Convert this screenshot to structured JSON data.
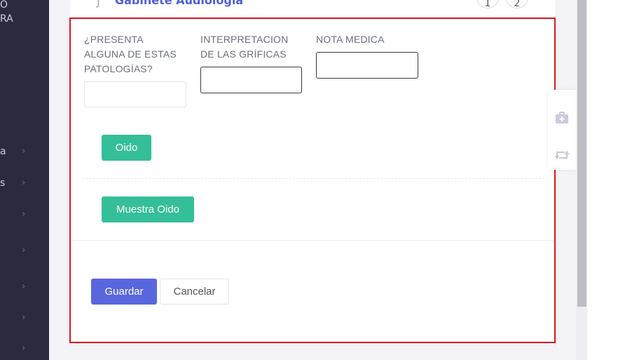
{
  "sidebar": {
    "fragments": [
      "O",
      "RA",
      "a",
      "s"
    ]
  },
  "top_card": {
    "title": "Gabinete Audiologia",
    "steps": [
      "1",
      "2"
    ]
  },
  "form": {
    "field1": {
      "label_lines": [
        "¿PRESENTA",
        "ALGUNA DE ESTAS",
        "PATOLOGÍAS?"
      ],
      "value": ""
    },
    "field2": {
      "label_lines": [
        "INTERPRETACION",
        "DE LAS GRÍFICAS"
      ],
      "value": ""
    },
    "field3": {
      "label_lines": [
        "NOTA MEDICA"
      ],
      "value": ""
    },
    "oido_button": "Oido",
    "muestra_oido_button": "Muestra Oido"
  },
  "actions": {
    "save_label": "Guardar",
    "cancel_label": "Cancelar"
  },
  "colors": {
    "accent": "#5867dd",
    "success": "#34bf98",
    "highlight_border": "#d71920",
    "sidebar_bg": "#2a2c3d"
  },
  "icons": {
    "toolbar": [
      "medkit-icon",
      "retweet-icon"
    ],
    "title": "stethoscope-icon"
  }
}
